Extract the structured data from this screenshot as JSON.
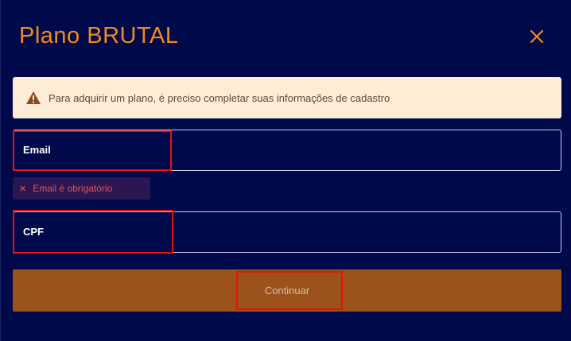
{
  "modal": {
    "title": "Plano BRUTAL",
    "close_icon": "close-icon",
    "accent_color": "#f08a1f"
  },
  "alert": {
    "icon": "warning-icon",
    "text": "Para adquirir um plano, é preciso completar suas informações de cadastro"
  },
  "form": {
    "email_label": "Email",
    "email_value": "",
    "email_error": "Email é obrigatório",
    "cpf_label": "CPF",
    "cpf_value": ""
  },
  "actions": {
    "continue_label": "Continuar",
    "button_color": "#9c521b"
  }
}
